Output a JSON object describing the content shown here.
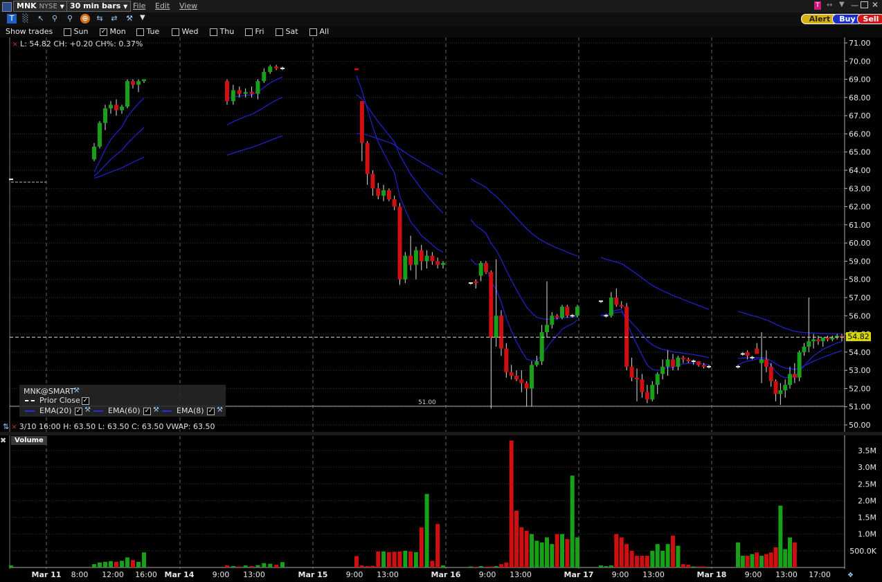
{
  "symbol": {
    "ticker": "MNK",
    "exchange": "NYSE"
  },
  "timeframe": "30 min bars",
  "menus": [
    "File",
    "Edit",
    "View"
  ],
  "order_buttons": {
    "alert": "Alert",
    "buy": "Buy",
    "sell": "Sell"
  },
  "show_trades": {
    "label": "Show trades",
    "days": [
      {
        "label": "Sun",
        "checked": false
      },
      {
        "label": "Mon",
        "checked": true
      },
      {
        "label": "Tue",
        "checked": false
      },
      {
        "label": "Wed",
        "checked": false
      },
      {
        "label": "Thu",
        "checked": false
      },
      {
        "label": "Fri",
        "checked": false
      },
      {
        "label": "Sat",
        "checked": false
      },
      {
        "label": "All",
        "checked": false
      }
    ]
  },
  "info_line": "L: 54.82  CH: +0.20  CH%: 0.37%",
  "hover_line": "3/10 16:00    H: 63.50  L: 63.50  C: 63.50  VWAP: 63.50",
  "legend": {
    "contract": "MNK@SMART",
    "prior_close": "Prior Close",
    "ema": [
      "EMA(20)",
      "EMA(60)",
      "EMA(8)"
    ]
  },
  "volume_label": "Volume",
  "low_marker": "51.00",
  "price_tag": "54.82",
  "colors": {
    "up": "#18a018",
    "down": "#d01010",
    "ema": "#2020c8",
    "grid": "#555555",
    "last": "#ffff66"
  },
  "chart_data": [
    {
      "type": "candlestick",
      "title": "",
      "ylim": [
        50.0,
        71.0
      ],
      "y_ticks": [
        "71.00",
        "70.00",
        "69.00",
        "68.00",
        "67.00",
        "66.00",
        "65.00",
        "64.00",
        "63.00",
        "62.00",
        "61.00",
        "60.00",
        "59.00",
        "58.00",
        "57.00",
        "56.00",
        "55.00",
        "54.00",
        "53.00",
        "52.00",
        "51.00",
        "50.00"
      ],
      "x_labels": [
        "Mar 11",
        "8:00",
        "12:00",
        "16:00",
        "Mar 14",
        "9:00",
        "13:00",
        "Mar 15",
        "9:00",
        "13:00",
        "Mar 16",
        "9:00",
        "13:00",
        "Mar 17",
        "9:00",
        "13:00",
        "Mar 18",
        "9:00",
        "13:00",
        "17:00"
      ],
      "prior_close": 54.62,
      "last": 54.82,
      "sessions": [
        {
          "name": "Mar 10",
          "candles": [
            [
              63.5,
              63.5,
              63.5,
              63.5
            ]
          ]
        },
        {
          "name": "Mar 11",
          "candles": [
            [
              64.6,
              65.5,
              64.5,
              65.3
            ],
            [
              65.3,
              66.7,
              65.2,
              66.6
            ],
            [
              66.6,
              67.6,
              66.2,
              67.4
            ],
            [
              67.4,
              67.8,
              67.1,
              67.6
            ],
            [
              67.6,
              67.9,
              67.0,
              67.3
            ],
            [
              67.3,
              67.6,
              67.1,
              67.5
            ],
            [
              67.5,
              69.0,
              67.4,
              68.9
            ],
            [
              68.9,
              69.0,
              68.5,
              68.7
            ],
            [
              68.7,
              69.0,
              68.3,
              68.9
            ],
            [
              68.9,
              69.0,
              68.8,
              69.0
            ]
          ]
        },
        {
          "name": "Mar 14",
          "candles": [
            [
              68.9,
              69.0,
              67.6,
              67.8
            ],
            [
              67.8,
              68.7,
              67.6,
              68.4
            ],
            [
              68.4,
              68.6,
              68.0,
              68.2
            ],
            [
              68.2,
              68.5,
              68.0,
              68.3
            ],
            [
              68.3,
              68.6,
              68.0,
              68.2
            ],
            [
              68.2,
              69.0,
              67.9,
              68.9
            ],
            [
              68.9,
              69.6,
              68.8,
              69.4
            ],
            [
              69.4,
              69.8,
              69.3,
              69.7
            ],
            [
              69.7,
              69.8,
              69.5,
              69.6
            ],
            [
              69.6,
              69.7,
              69.5,
              69.6
            ]
          ]
        },
        {
          "name": "Mar 15",
          "candles": [
            [
              69.6,
              69.6,
              69.5,
              69.5
            ],
            [
              67.8,
              67.8,
              64.5,
              65.5
            ],
            [
              65.5,
              65.6,
              63.2,
              63.8
            ],
            [
              63.8,
              64.0,
              62.6,
              63.0
            ],
            [
              63.0,
              63.3,
              62.4,
              62.6
            ],
            [
              62.6,
              63.2,
              62.3,
              62.9
            ],
            [
              62.9,
              63.0,
              62.3,
              62.4
            ],
            [
              62.4,
              62.6,
              61.8,
              62.0
            ],
            [
              62.0,
              62.2,
              57.7,
              58.0
            ],
            [
              58.0,
              59.5,
              57.8,
              59.3
            ],
            [
              59.3,
              60.4,
              58.5,
              58.8
            ],
            [
              58.8,
              59.8,
              58.0,
              59.6
            ],
            [
              59.6,
              59.9,
              58.5,
              59.0
            ],
            [
              59.0,
              59.6,
              58.6,
              59.3
            ],
            [
              59.3,
              59.5,
              58.8,
              59.0
            ],
            [
              59.0,
              59.2,
              58.6,
              58.8
            ],
            [
              58.8,
              59.0,
              58.6,
              58.9
            ]
          ]
        },
        {
          "name": "Mar 16",
          "candles": [
            [
              57.8,
              57.8,
              57.7,
              57.8
            ],
            [
              57.9,
              58.0,
              57.5,
              57.8
            ],
            [
              58.2,
              59.0,
              57.9,
              58.9
            ],
            [
              58.9,
              59.0,
              58.3,
              58.4
            ],
            [
              58.4,
              58.5,
              50.9,
              54.8
            ],
            [
              54.8,
              59.1,
              54.3,
              56.0
            ],
            [
              56.0,
              56.3,
              53.8,
              54.2
            ],
            [
              54.2,
              54.5,
              52.6,
              52.9
            ],
            [
              52.9,
              53.3,
              52.5,
              52.7
            ],
            [
              52.7,
              53.0,
              52.4,
              52.5
            ],
            [
              52.5,
              53.0,
              51.8,
              52.3
            ],
            [
              52.3,
              52.4,
              51.0,
              52.0
            ],
            [
              52.0,
              53.5,
              51.0,
              53.3
            ],
            [
              53.3,
              53.8,
              53.2,
              53.5
            ],
            [
              53.5,
              55.5,
              53.3,
              55.1
            ],
            [
              55.1,
              57.9,
              54.8,
              55.5
            ],
            [
              55.5,
              56.2,
              55.3,
              56.0
            ],
            [
              56.0,
              56.1,
              55.8,
              55.9
            ],
            [
              55.9,
              56.6,
              55.8,
              56.5
            ],
            [
              56.5,
              56.6,
              55.9,
              56.0
            ],
            [
              56.0,
              56.1,
              55.9,
              56.0
            ],
            [
              56.0,
              56.6,
              55.9,
              56.5
            ]
          ]
        },
        {
          "name": "Mar 17",
          "candles": [
            [
              56.8,
              56.8,
              56.7,
              56.8
            ],
            [
              56.0,
              56.1,
              55.9,
              56.0
            ],
            [
              56.0,
              57.3,
              55.9,
              57.0
            ],
            [
              57.0,
              57.5,
              56.5,
              56.6
            ],
            [
              56.6,
              56.8,
              56.4,
              56.5
            ],
            [
              56.5,
              56.7,
              53.0,
              53.2
            ],
            [
              53.2,
              53.7,
              52.4,
              52.6
            ],
            [
              52.6,
              53.1,
              51.3,
              52.5
            ],
            [
              52.5,
              52.8,
              51.5,
              51.8
            ],
            [
              51.8,
              52.2,
              51.2,
              51.4
            ],
            [
              51.4,
              52.4,
              51.3,
              52.2
            ],
            [
              52.2,
              52.9,
              51.7,
              52.8
            ],
            [
              52.8,
              53.6,
              52.5,
              53.2
            ],
            [
              53.2,
              54.1,
              52.7,
              53.6
            ],
            [
              53.6,
              53.9,
              53.0,
              53.2
            ],
            [
              53.2,
              53.8,
              53.0,
              53.7
            ],
            [
              53.7,
              53.8,
              53.4,
              53.6
            ],
            [
              53.6,
              53.7,
              53.4,
              53.5
            ],
            [
              53.5,
              53.6,
              53.3,
              53.5
            ],
            [
              53.5,
              53.5,
              53.2,
              53.3
            ],
            [
              53.3,
              53.4,
              53.1,
              53.2
            ],
            [
              53.2,
              53.3,
              53.1,
              53.2
            ]
          ]
        },
        {
          "name": "Mar 18",
          "candles": [
            [
              53.2,
              53.3,
              53.1,
              53.2
            ],
            [
              53.9,
              54.0,
              53.8,
              53.9
            ],
            [
              54.0,
              54.1,
              53.6,
              53.8
            ],
            [
              53.7,
              53.8,
              53.6,
              53.7
            ],
            [
              54.2,
              54.5,
              53.9,
              53.9
            ],
            [
              53.4,
              55.1,
              52.3,
              53.6
            ],
            [
              53.6,
              54.1,
              52.9,
              53.2
            ],
            [
              53.2,
              53.4,
              52.1,
              52.4
            ],
            [
              52.4,
              52.5,
              51.3,
              51.7
            ],
            [
              51.7,
              52.3,
              51.1,
              51.9
            ],
            [
              51.9,
              52.5,
              51.5,
              52.2
            ],
            [
              52.2,
              53.2,
              52.0,
              52.8
            ],
            [
              52.8,
              53.4,
              52.3,
              52.6
            ],
            [
              52.6,
              54.1,
              52.4,
              54.0
            ],
            [
              54.0,
              54.5,
              53.8,
              54.3
            ],
            [
              54.3,
              57.0,
              54.0,
              54.6
            ],
            [
              54.6,
              55.0,
              54.2,
              54.7
            ],
            [
              54.7,
              54.9,
              54.4,
              54.6
            ],
            [
              54.6,
              54.8,
              54.3,
              54.8
            ],
            [
              54.8,
              54.9,
              54.6,
              54.7
            ],
            [
              54.7,
              54.9,
              54.6,
              54.8
            ],
            [
              54.8,
              55.0,
              54.7,
              54.9
            ],
            [
              54.9,
              55.0,
              54.6,
              54.8
            ]
          ]
        }
      ]
    },
    {
      "type": "bar",
      "title": "Volume",
      "ylim": [
        0,
        3900000
      ],
      "y_ticks": [
        "3.5M",
        "3.0M",
        "2.5M",
        "2.0M",
        "1.5M",
        "1.0M",
        "500.0K"
      ],
      "series": [
        {
          "values": [
            60000,
            100000,
            150000,
            170000,
            190000,
            170000,
            200000,
            300000,
            220000,
            170000,
            450000,
            60000,
            40000,
            30000,
            60000,
            40000,
            70000,
            130000,
            110000,
            80000,
            160000,
            340000,
            60000,
            40000,
            50000,
            480000,
            480000,
            460000,
            470000,
            480000,
            500000,
            480000,
            460000,
            1200000,
            2200000,
            200000,
            1300000,
            60000,
            30000,
            20000,
            40000,
            20000,
            30000,
            40000,
            100000,
            150000,
            3800000,
            1700000,
            1200000,
            1100000,
            1000000,
            800000,
            750000,
            900000,
            700000,
            1000000,
            1000000,
            850000,
            2750000,
            900000,
            60000,
            40000,
            60000,
            1000000,
            900000,
            700000,
            500000,
            350000,
            350000,
            350000,
            500000,
            700000,
            500000,
            700000,
            950000,
            650000,
            100000,
            80000,
            30000,
            30000,
            30000,
            20000,
            750000,
            350000,
            350000,
            400000,
            450000,
            350000,
            400000,
            450000,
            600000,
            1850000,
            550000,
            900000,
            750000
          ]
        }
      ]
    }
  ]
}
